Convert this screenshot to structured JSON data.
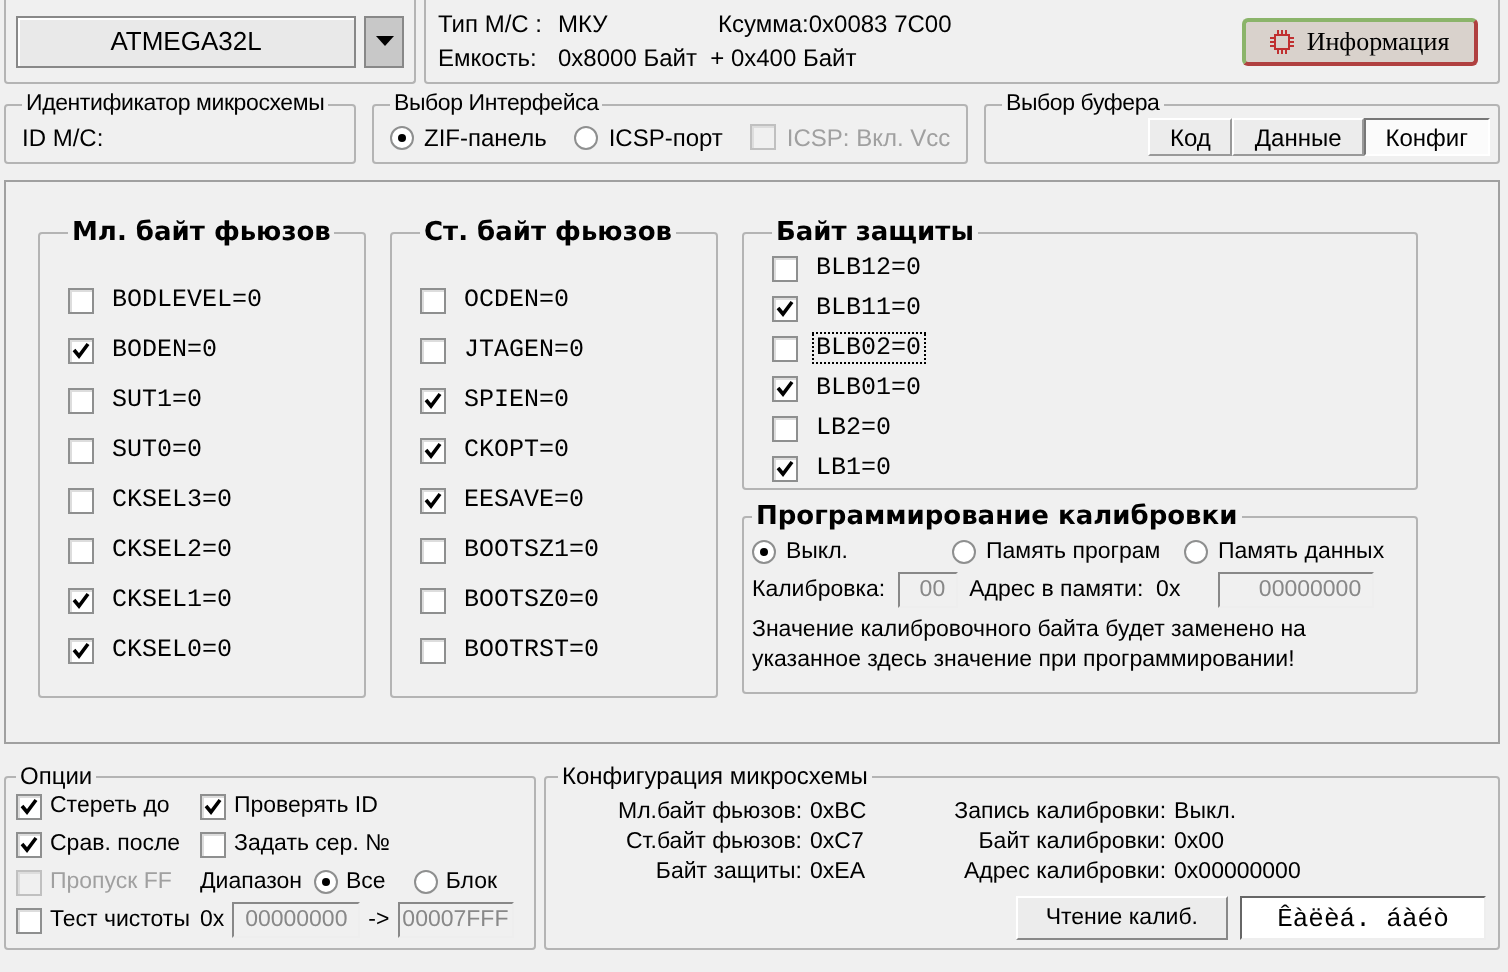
{
  "chip_select": {
    "value": "ATMEGA32L"
  },
  "chip_info": {
    "type_label": "Тип М/С :",
    "type_value": "МКУ",
    "checksum": "Ксумма:0x0083 7C00",
    "capacity_label": "Емкость:",
    "capacity_value": "0x8000 Байт  + 0x400 Байт"
  },
  "info_button": {
    "label": "Информация"
  },
  "chip_id": {
    "title": "Идентификатор микросхемы",
    "label": "ID М/С:"
  },
  "interface": {
    "title": "Выбор Интерфейса",
    "options": [
      {
        "label": "ZIF-панель",
        "selected": true
      },
      {
        "label": "ICSP-порт",
        "selected": false
      }
    ],
    "vcc": {
      "label": "ICSP: Вкл. Vcc",
      "checked": false,
      "disabled": true
    }
  },
  "buffer": {
    "title": "Выбор буфера",
    "tabs": [
      {
        "label": "Код",
        "selected": false
      },
      {
        "label": "Данные",
        "selected": false
      },
      {
        "label": "Конфиг",
        "selected": true
      }
    ]
  },
  "fuse_groups": [
    {
      "title": "Мл. байт фьюзов",
      "bits": [
        {
          "label": "BODLEVEL=0",
          "checked": false
        },
        {
          "label": "BODEN=0",
          "checked": true
        },
        {
          "label": "SUT1=0",
          "checked": false
        },
        {
          "label": "SUT0=0",
          "checked": false
        },
        {
          "label": "CKSEL3=0",
          "checked": false
        },
        {
          "label": "CKSEL2=0",
          "checked": false
        },
        {
          "label": "CKSEL1=0",
          "checked": true
        },
        {
          "label": "CKSEL0=0",
          "checked": true
        }
      ]
    },
    {
      "title": "Ст. байт фьюзов",
      "bits": [
        {
          "label": "OCDEN=0",
          "checked": false
        },
        {
          "label": "JTAGEN=0",
          "checked": false
        },
        {
          "label": "SPIEN=0",
          "checked": true
        },
        {
          "label": "CKOPT=0",
          "checked": true
        },
        {
          "label": "EESAVE=0",
          "checked": true
        },
        {
          "label": "BOOTSZ1=0",
          "checked": false
        },
        {
          "label": "BOOTSZ0=0",
          "checked": false
        },
        {
          "label": "BOOTRST=0",
          "checked": false
        }
      ]
    }
  ],
  "lock_byte": {
    "title": "Байт защиты",
    "bits": [
      {
        "label": "BLB12=0",
        "checked": false,
        "focused": false
      },
      {
        "label": "BLB11=0",
        "checked": true,
        "focused": false
      },
      {
        "label": "BLB02=0",
        "checked": false,
        "focused": true
      },
      {
        "label": "BLB01=0",
        "checked": true,
        "focused": false
      },
      {
        "label": "LB2=0",
        "checked": false,
        "focused": false
      },
      {
        "label": "LB1=0",
        "checked": true,
        "focused": false
      }
    ]
  },
  "calibration": {
    "title": "Программирование калибровки",
    "modes": [
      {
        "label": "Выкл.",
        "selected": true
      },
      {
        "label": "Память програм",
        "selected": false
      },
      {
        "label": "Память данных",
        "selected": false
      }
    ],
    "value_label": "Калибровка:",
    "value": "00",
    "address_label": "Адрес в памяти:  0x",
    "address": "00000000",
    "note": "Значение калибровочного байта будет заменено на указанное здесь значение при программировании!"
  },
  "options": {
    "title": "Опции",
    "items": [
      {
        "kind": "checkbox",
        "label": "Стереть до",
        "checked": true,
        "disabled": false
      },
      {
        "kind": "checkbox",
        "label": "Проверять ID",
        "checked": true,
        "disabled": false
      },
      {
        "kind": "checkbox",
        "label": "Срав. после",
        "checked": true,
        "disabled": false
      },
      {
        "kind": "checkbox",
        "label": "Задать сер. №",
        "checked": false,
        "disabled": false
      },
      {
        "kind": "checkbox",
        "label": "Пропуск FF",
        "checked": false,
        "disabled": true
      },
      {
        "kind": "range",
        "label": "Диапазон",
        "options": [
          {
            "label": "Все",
            "selected": true
          },
          {
            "label": "Блок",
            "selected": false
          }
        ]
      },
      {
        "kind": "checkbox",
        "label": "Тест чистоты",
        "checked": false,
        "disabled": false
      },
      {
        "kind": "address",
        "prefix": "0x",
        "from": "00000000",
        "arrow": "->",
        "to": "00007FFF"
      }
    ]
  },
  "config": {
    "title": "Конфигурация микросхемы",
    "left": [
      {
        "label": "Мл.байт фьюзов:",
        "value": "0xBC"
      },
      {
        "label": "Ст.байт фьюзов:",
        "value": "0xC7"
      },
      {
        "label": "Байт защиты:",
        "value": "0xEA"
      }
    ],
    "right": [
      {
        "label": "Запись калибровки:",
        "value": "Выкл."
      },
      {
        "label": "Байт калибровки:",
        "value": "0x00"
      },
      {
        "label": "Адрес калибровки:",
        "value": "0x00000000"
      }
    ],
    "read_button": "Чтение калиб.",
    "status": "Êàëèá. áàéò"
  }
}
